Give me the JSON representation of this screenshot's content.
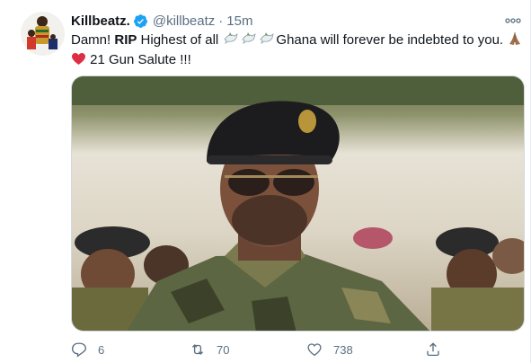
{
  "tweet": {
    "display_name": "Killbeatz.",
    "verified_icon": "verified-badge-icon",
    "handle": "@killbeatz",
    "separator": "·",
    "time": "15m",
    "text": {
      "part1": "Damn! ",
      "bold": "RIP",
      "part2": " Highest of all ",
      "part3": "Ghana will forever be indebted to you. ",
      "part4": " 21 Gun Salute !!!"
    },
    "emoji": {
      "dove": "dove-icon",
      "pray": "folded-hands-icon",
      "heart": "red-heart-icon"
    },
    "media_alt": "photo"
  },
  "actions": {
    "reply_count": "6",
    "retweet_count": "70",
    "like_count": "738"
  },
  "colors": {
    "accent": "#1da1f2",
    "secondary_text": "#5b7083",
    "heart": "#e0245e"
  }
}
